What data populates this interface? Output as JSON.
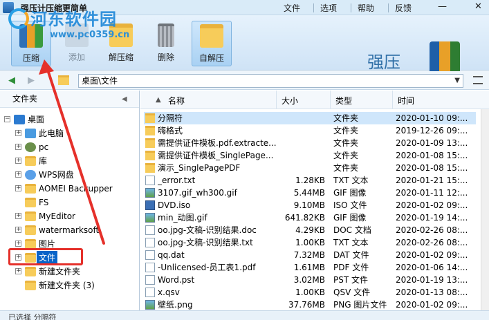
{
  "titlebar": {
    "title": "强压计压缩更简单",
    "watermark": "河东软件园",
    "watermark_url": "www.pc0359.cn",
    "menu": [
      "文件",
      "选项",
      "帮助",
      "反馈"
    ],
    "minimize": "—",
    "close": "✕"
  },
  "toolbar": {
    "buttons": [
      "压缩",
      "添加",
      "解压缩",
      "删除",
      "自解压"
    ],
    "brand": "强压"
  },
  "address": {
    "path": "桌面\\文件"
  },
  "sidebar": {
    "header": "文件夹",
    "items": [
      "桌面",
      "此电脑",
      "pc",
      "库",
      "WPS网盘",
      "AOMEI Backupper",
      "FS",
      "MyEditor",
      "watermarksoft",
      "图片",
      "文件",
      "新建文件夹",
      "新建文件夹 (3)"
    ]
  },
  "filelist": {
    "columns": [
      "名称",
      "大小",
      "类型",
      "时间"
    ],
    "rows": [
      {
        "name": "分隔符",
        "size": "",
        "type": "文件夹",
        "time": "2020-01-10 09:..."
      },
      {
        "name": "嗨格式",
        "size": "",
        "type": "文件夹",
        "time": "2019-12-26 09:..."
      },
      {
        "name": "需提供证件模板.pdf.extracte...",
        "size": "",
        "type": "文件夹",
        "time": "2020-01-09 13:..."
      },
      {
        "name": "需提供证件模板_SinglePage...",
        "size": "",
        "type": "文件夹",
        "time": "2020-01-08 15:..."
      },
      {
        "name": "演示_SinglePagePDF",
        "size": "",
        "type": "文件夹",
        "time": "2020-01-08 15:..."
      },
      {
        "name": "_error.txt",
        "size": "1.28KB",
        "type": "TXT 文本",
        "time": "2020-01-21 15:..."
      },
      {
        "name": "3107.gif_wh300.gif",
        "size": "5.44MB",
        "type": "GIF 图像",
        "time": "2020-01-11 12:..."
      },
      {
        "name": "DVD.iso",
        "size": "9.10MB",
        "type": "ISO 文件",
        "time": "2020-01-02 09:..."
      },
      {
        "name": "min_动图.gif",
        "size": "641.82KB",
        "type": "GIF 图像",
        "time": "2020-01-19 14:..."
      },
      {
        "name": "oo.jpg-文稿-识别结果.doc",
        "size": "4.29KB",
        "type": "DOC 文档",
        "time": "2020-02-26 08:..."
      },
      {
        "name": "oo.jpg-文稿-识别结果.txt",
        "size": "1.00KB",
        "type": "TXT 文本",
        "time": "2020-02-26 08:..."
      },
      {
        "name": "qq.dat",
        "size": "7.32MB",
        "type": "DAT 文件",
        "time": "2020-01-02 09:..."
      },
      {
        "name": "-Unlicensed-员工表1.pdf",
        "size": "1.61MB",
        "type": "PDF 文件",
        "time": "2020-01-06 14:..."
      },
      {
        "name": "Word.pst",
        "size": "3.02MB",
        "type": "PST 文件",
        "time": "2020-01-19 13:..."
      },
      {
        "name": "x.qsv",
        "size": "1.00KB",
        "type": "QSV 文件",
        "time": "2020-01-13 08:..."
      },
      {
        "name": "壁纸.png",
        "size": "37.76MB",
        "type": "PNG 图片文件",
        "time": "2020-01-02 09:..."
      }
    ]
  },
  "status": {
    "text": "已选择 分隔符"
  },
  "colors": {
    "accent": "#0a64c8",
    "highlight_box": "#e5302a",
    "toolbar_bg": "#d6e8f8"
  }
}
